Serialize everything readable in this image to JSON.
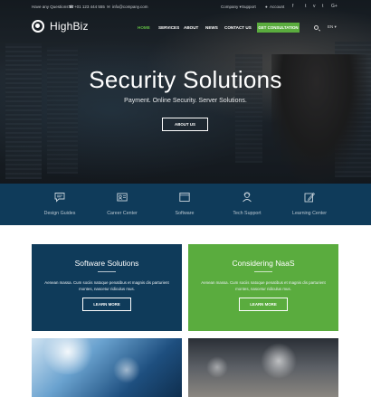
{
  "topbar": {
    "question": "Have any Questions?",
    "phone": "+01 123 444 555",
    "email": "info@company.com",
    "company": "Company",
    "support": "Support",
    "account": "Account"
  },
  "brand": {
    "name": "HighBiz"
  },
  "nav": {
    "home": "HOME",
    "services": "SERVICES",
    "about": "ABOUT",
    "news": "NEWS",
    "contact": "CONTACT US",
    "cta": "GET CONSULTATION",
    "lang": "EN"
  },
  "hero": {
    "title": "Security Solutions",
    "subtitle": "Payment. Online Security. Server Solutions.",
    "button": "ABOUT US"
  },
  "features": [
    {
      "label": "Design Guides",
      "icon": "chat-icon"
    },
    {
      "label": "Career Center",
      "icon": "id-card-icon"
    },
    {
      "label": "Software",
      "icon": "window-icon"
    },
    {
      "label": "Tech Support",
      "icon": "user-support-icon"
    },
    {
      "label": "Learning Center",
      "icon": "edit-icon"
    }
  ],
  "cards": [
    {
      "title": "Software Solutions",
      "body": "Aenean massa. Cum sociis natoque penatibus et magnis dis parturient montes, nascetur ridiculus mus.",
      "button": "LEARN MORE"
    },
    {
      "title": "Considering NaaS",
      "body": "Aenean massa. Cum sociis natoque penatibus et magnis dis parturient montes, nascetur ridiculus mus.",
      "button": "LEARN MORE"
    }
  ],
  "colors": {
    "primary": "#0f3b5a",
    "accent": "#5aac3e"
  }
}
